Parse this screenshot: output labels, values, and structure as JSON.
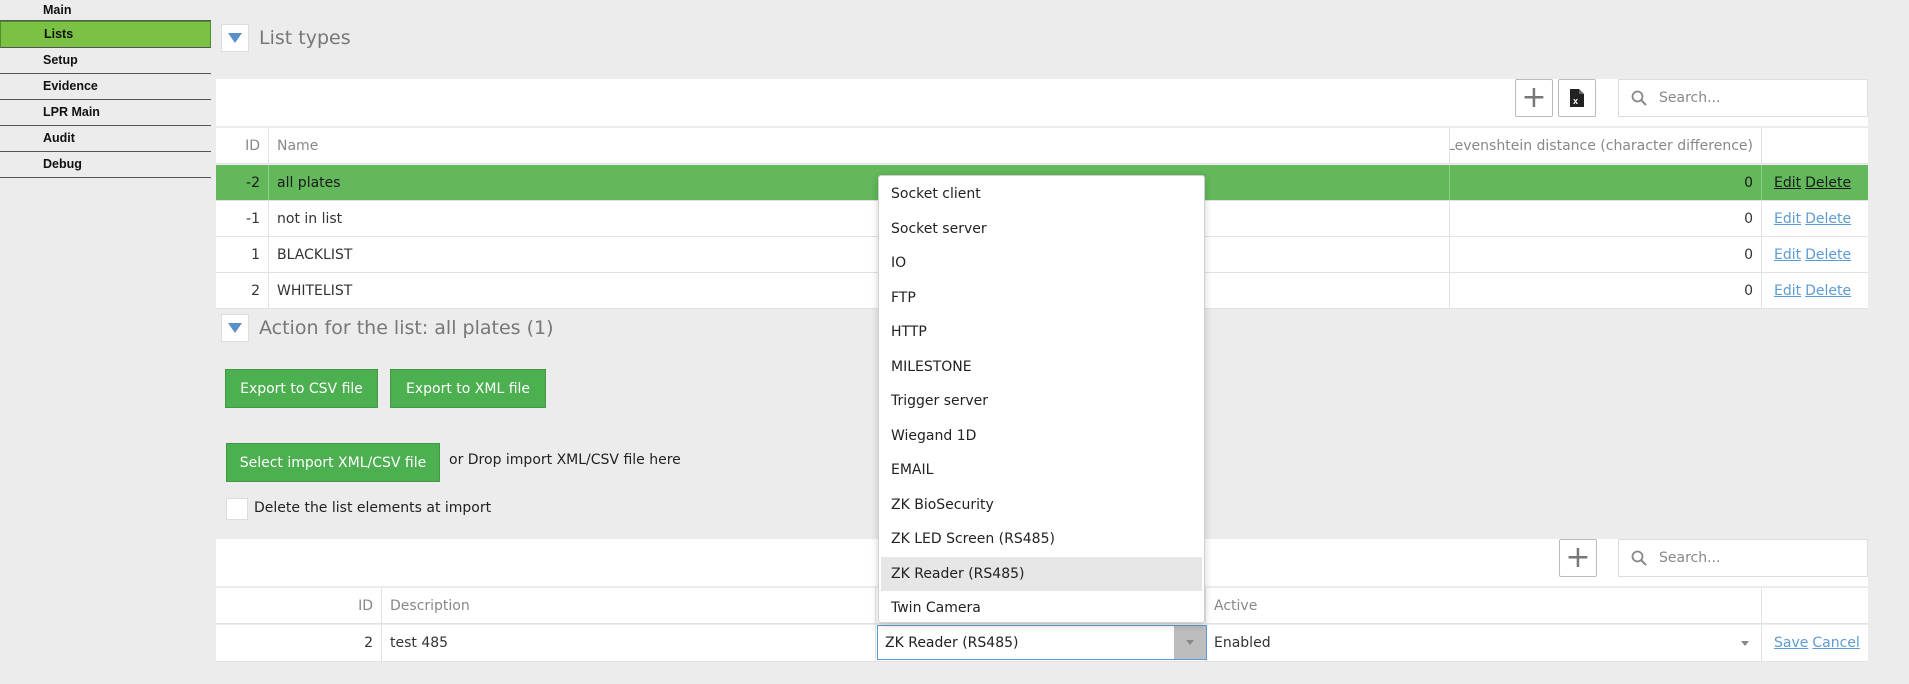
{
  "sidebar": {
    "items": [
      {
        "label": "Main"
      },
      {
        "label": "Lists"
      },
      {
        "label": "Setup"
      },
      {
        "label": "Evidence"
      },
      {
        "label": "LPR Main"
      },
      {
        "label": "Audit"
      },
      {
        "label": "Debug"
      }
    ],
    "active": "Lists"
  },
  "list_types": {
    "title": "List types",
    "search_placeholder": "Search...",
    "columns": [
      "ID",
      "Name",
      "Levenshtein distance (character difference)",
      ""
    ],
    "rows": [
      {
        "id": "-2",
        "name": "all plates",
        "distance": "0",
        "edit": "Edit",
        "delete": "Delete",
        "selected": true
      },
      {
        "id": "-1",
        "name": "not in list",
        "distance": "0",
        "edit": "Edit",
        "delete": "Delete"
      },
      {
        "id": "1",
        "name": "BLACKLIST",
        "distance": "0",
        "edit": "Edit",
        "delete": "Delete"
      },
      {
        "id": "2",
        "name": "WHITELIST",
        "distance": "0",
        "edit": "Edit",
        "delete": "Delete"
      }
    ]
  },
  "actions": {
    "title": "Action for the list: all plates (1)",
    "export_csv": "Export to CSV file",
    "export_xml": "Export to XML file",
    "select_import": "Select import XML/CSV file",
    "drop_hint": "or Drop import XML/CSV file here",
    "delete_on_import": "Delete the list elements at import",
    "search_placeholder": "Search...",
    "columns": [
      "ID",
      "Description",
      "",
      "Active",
      ""
    ],
    "edit_row": {
      "id": "2",
      "description": "test 485",
      "type": "ZK Reader (RS485)",
      "active": "Enabled",
      "save": "Save",
      "cancel": "Cancel"
    }
  },
  "dropdown": {
    "options": [
      "Socket client",
      "Socket server",
      "IO",
      "FTP",
      "HTTP",
      "MILESTONE",
      "Trigger server",
      "Wiegand 1D",
      "EMAIL",
      "ZK BioSecurity",
      "ZK LED Screen (RS485)",
      "ZK Reader (RS485)",
      "Twin Camera"
    ],
    "highlighted": "ZK Reader (RS485)"
  },
  "colors": {
    "active_nav": "#7bc143",
    "selected_row": "#62b85a",
    "button_green": "#4caf50",
    "link": "#5b9bd5"
  }
}
